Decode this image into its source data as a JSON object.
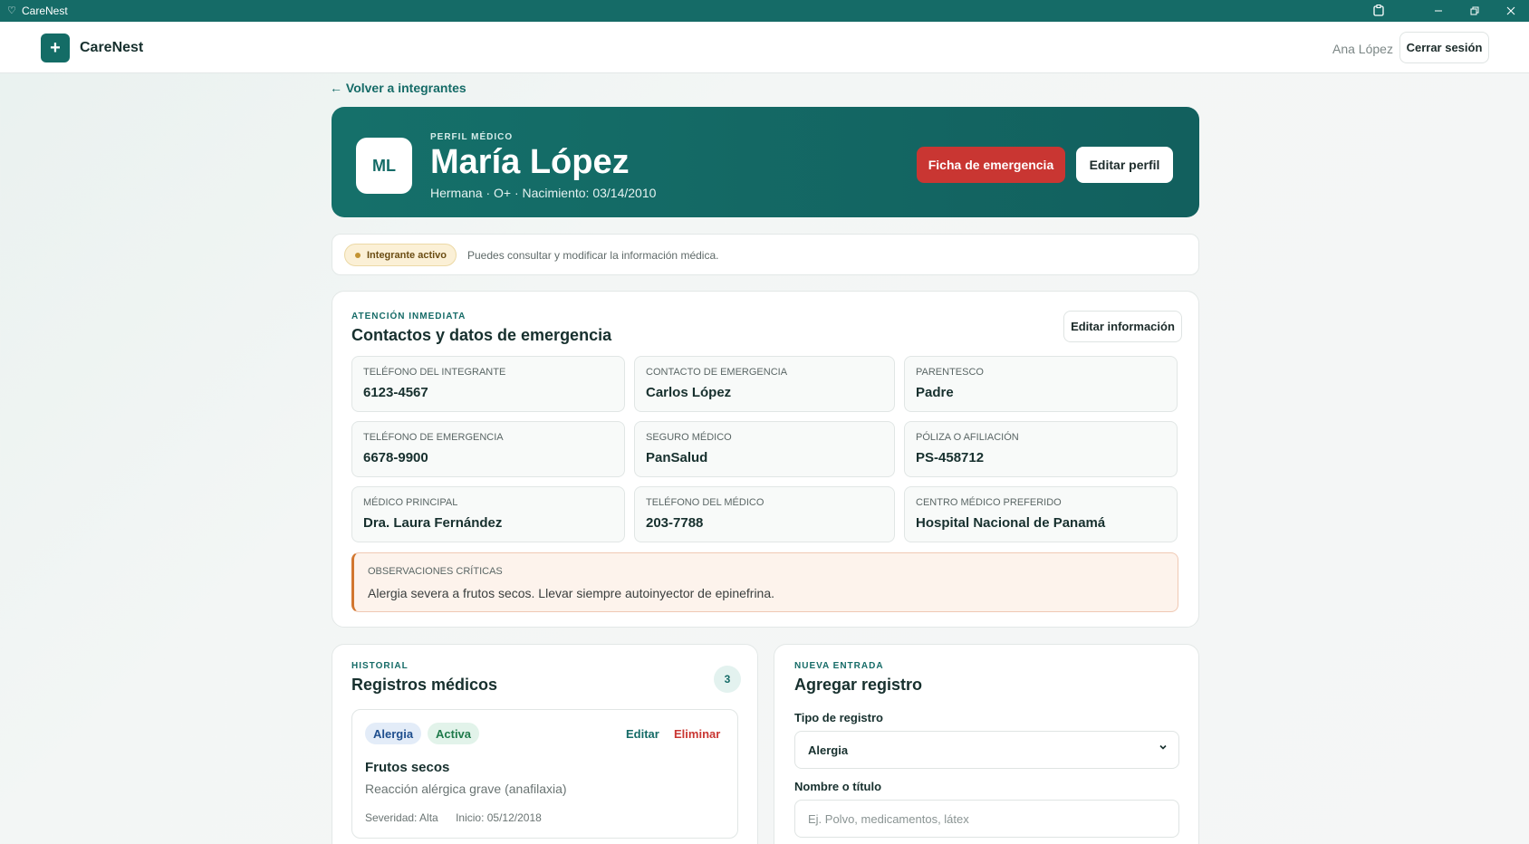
{
  "window": {
    "title": "CareNest",
    "app_icon": "heart-icon",
    "controls": [
      "extension-icon",
      "minimize-icon",
      "restore-icon",
      "close-icon"
    ]
  },
  "header": {
    "logo_symbol": "+",
    "brand": "CareNest",
    "user_name": "Ana López",
    "logout_label": "Cerrar sesión"
  },
  "nav": {
    "back_label": "← Volver a integrantes"
  },
  "profile": {
    "eyebrow": "PERFIL MÉDICO",
    "initials": "ML",
    "name": "María López",
    "subtitle": "Hermana · O+ · Nacimiento: 03/14/2010",
    "emergency_button": "Ficha de emergencia",
    "edit_button": "Editar perfil",
    "colors": {
      "hero": "#15706a",
      "emergency": "#c93632"
    }
  },
  "status": {
    "badge": "Integrante activo",
    "message": "Puedes consultar y modificar la información médica."
  },
  "emergency": {
    "eyebrow": "ATENCIÓN INMEDIATA",
    "title": "Contactos y datos de emergencia",
    "edit_button": "Editar información",
    "fields": [
      {
        "label": "TELÉFONO DEL INTEGRANTE",
        "value": "6123-4567"
      },
      {
        "label": "CONTACTO DE EMERGENCIA",
        "value": "Carlos López"
      },
      {
        "label": "PARENTESCO",
        "value": "Padre"
      },
      {
        "label": "TELÉFONO DE EMERGENCIA",
        "value": "6678-9900"
      },
      {
        "label": "SEGURO MÉDICO",
        "value": "PanSalud"
      },
      {
        "label": "PÓLIZA O AFILIACIÓN",
        "value": "PS-458712"
      },
      {
        "label": "MÉDICO PRINCIPAL",
        "value": "Dra. Laura Fernández"
      },
      {
        "label": "TELÉFONO DEL MÉDICO",
        "value": "203-7788"
      },
      {
        "label": "CENTRO MÉDICO PREFERIDO",
        "value": "Hospital Nacional de Panamá"
      }
    ],
    "critical": {
      "label": "OBSERVACIONES CRÍTICAS",
      "text": "Alergia severa a frutos secos. Llevar siempre autoinyector de epinefrina."
    }
  },
  "history": {
    "eyebrow": "HISTORIAL",
    "title": "Registros médicos",
    "count": "3",
    "records": [
      {
        "type": "Alergia",
        "state": "Activa",
        "edit": "Editar",
        "delete": "Eliminar",
        "title": "Frutos secos",
        "description": "Reacción alérgica grave (anafilaxia)",
        "severity": "Severidad: Alta",
        "start": "Inicio: 05/12/2018"
      }
    ]
  },
  "new_entry": {
    "eyebrow": "NUEVA ENTRADA",
    "title": "Agregar registro",
    "type_label": "Tipo de registro",
    "type_value": "Alergia",
    "name_label": "Nombre o título",
    "name_value": "",
    "name_placeholder": "Ej. Polvo, medicamentos, látex"
  }
}
